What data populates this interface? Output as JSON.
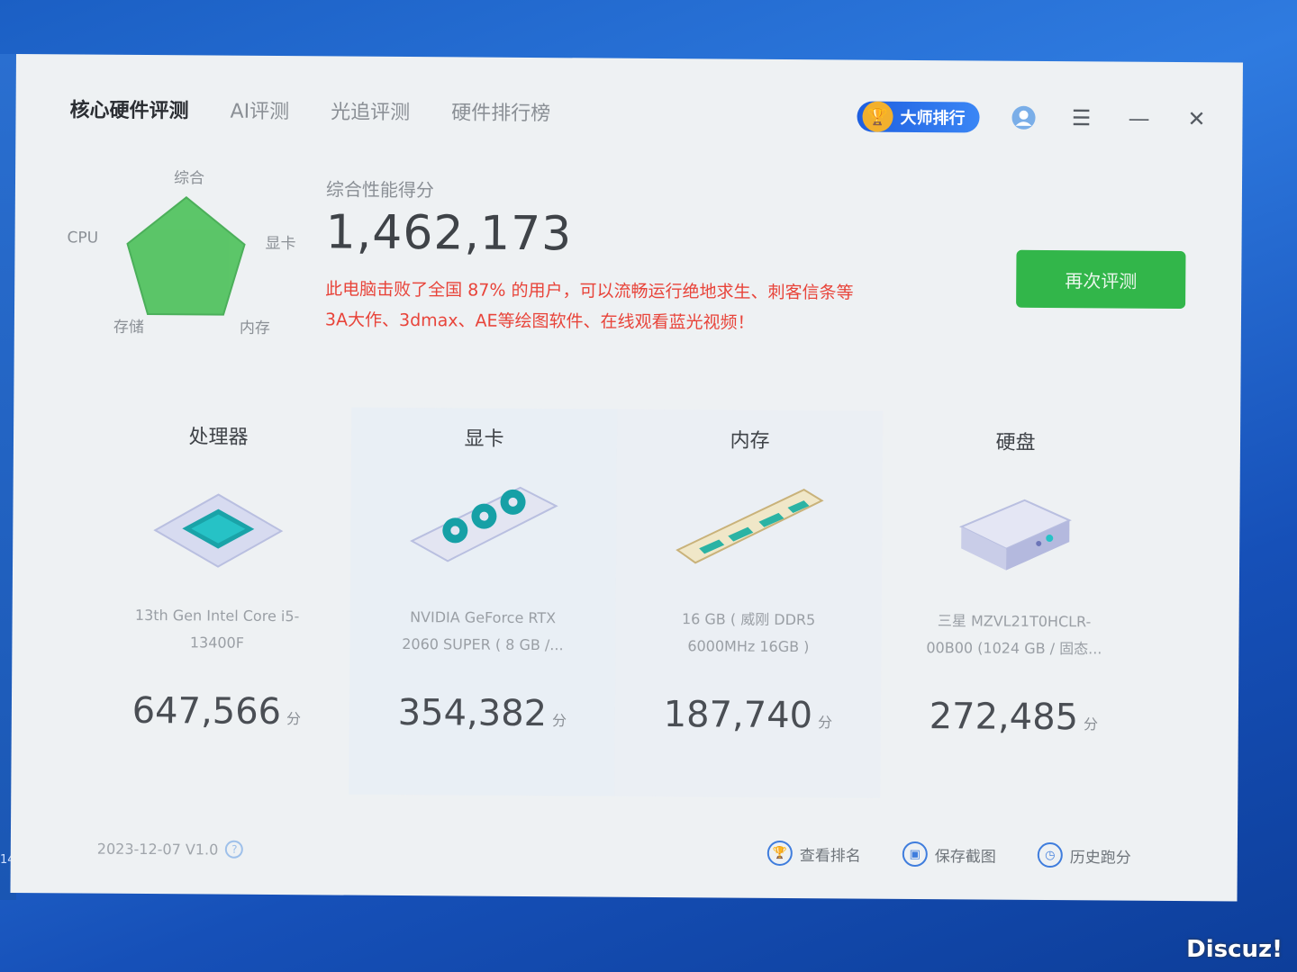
{
  "tabs": [
    {
      "label": "核心硬件评测",
      "active": true
    },
    {
      "label": "AI评测",
      "active": false
    },
    {
      "label": "光追评测",
      "active": false
    },
    {
      "label": "硬件排行榜",
      "active": false
    }
  ],
  "header": {
    "master_rank_label": "大师排行",
    "trophy_icon": "trophy-icon",
    "user_icon": "user-icon",
    "menu_icon": "menu-icon",
    "minimize_icon": "minimize-icon",
    "close_icon": "close-icon"
  },
  "radar": {
    "labels": {
      "top": "综合",
      "right": "显卡",
      "bottom_right": "内存",
      "bottom_left": "存储",
      "left": "CPU"
    },
    "fill_color": "#4cc15a"
  },
  "summary": {
    "title": "综合性能得分",
    "score": "1,462,173",
    "description_line1": "此电脑击败了全国 87% 的用户，可以流畅运行绝地求生、刺客信条等",
    "description_line2": "3A大作、3dmax、AE等绘图软件、在线观看蓝光视频！",
    "accent_color": "#e8443a"
  },
  "retest_button": {
    "label": "再次评测",
    "color": "#32b64a"
  },
  "components": [
    {
      "title": "处理器",
      "model_line1": "13th Gen Intel Core i5-",
      "model_line2": "13400F",
      "score": "647,566",
      "unit": "分",
      "icon": "cpu-icon"
    },
    {
      "title": "显卡",
      "model_line1": "NVIDIA GeForce RTX",
      "model_line2": "2060 SUPER ( 8 GB /...",
      "score": "354,382",
      "unit": "分",
      "icon": "gpu-icon"
    },
    {
      "title": "内存",
      "model_line1": "16 GB ( 威刚 DDR5",
      "model_line2": "6000MHz 16GB )",
      "score": "187,740",
      "unit": "分",
      "icon": "memory-icon"
    },
    {
      "title": "硬盘",
      "model_line1": "三星 MZVL21T0HCLR-",
      "model_line2": "00B00 (1024 GB / 固态...",
      "score": "272,485",
      "unit": "分",
      "icon": "disk-icon"
    }
  ],
  "footer": {
    "version": "2023-12-07 V1.0",
    "actions": [
      {
        "label": "查看排名",
        "icon": "trophy-outline-icon"
      },
      {
        "label": "保存截图",
        "icon": "screenshot-icon"
      },
      {
        "label": "历史跑分",
        "icon": "history-icon"
      }
    ]
  },
  "side_text": "14",
  "watermark": "Discuz!"
}
